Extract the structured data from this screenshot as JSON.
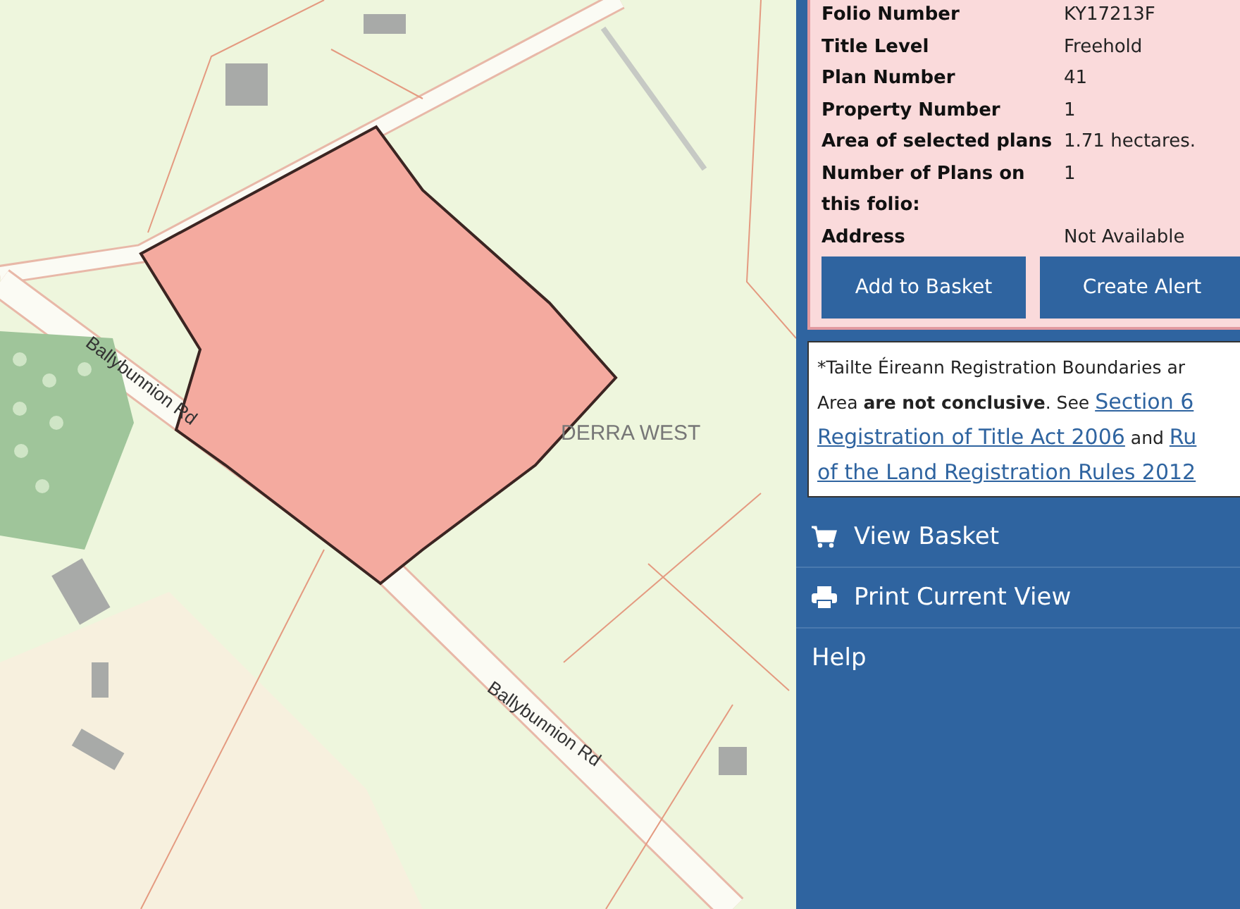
{
  "map": {
    "labels": [
      {
        "text": "Ballybunnion Rd",
        "kind": "road"
      },
      {
        "text": "Ballybunnion Rd",
        "kind": "road"
      },
      {
        "text": "DERRA WEST",
        "kind": "place"
      }
    ]
  },
  "details": {
    "rows": [
      {
        "label": "Folio Number",
        "value": "KY17213F"
      },
      {
        "label": "Title Level",
        "value": "Freehold"
      },
      {
        "label": "Plan Number",
        "value": "41"
      },
      {
        "label": "Property Number",
        "value": "1"
      },
      {
        "label": "Area of selected plans",
        "value": "1.71 hectares."
      },
      {
        "label": "Number of Plans on this folio:",
        "value": "1"
      },
      {
        "label": "Address",
        "value": "Not Available"
      }
    ],
    "buttons": [
      "Add to Basket",
      "Create Alert"
    ]
  },
  "notice": {
    "lines": [
      [
        {
          "kind": "text",
          "text": "*Tailte Éireann Registration Boundaries ar"
        }
      ],
      [
        {
          "kind": "text",
          "text": "Area **are not conclusive**. See "
        },
        {
          "kind": "link",
          "text": "Section 6"
        }
      ],
      [
        {
          "kind": "link",
          "text": "Registration of Title Act 2006"
        },
        {
          "kind": "text",
          "text": " and "
        },
        {
          "kind": "link",
          "text": "Ru"
        }
      ],
      [
        {
          "kind": "link",
          "text": "of the Land Registration Rules 2012"
        }
      ]
    ]
  },
  "menu": [
    {
      "label": "View Basket"
    },
    {
      "label": "Print Current View"
    },
    {
      "label": "Help"
    }
  ]
}
